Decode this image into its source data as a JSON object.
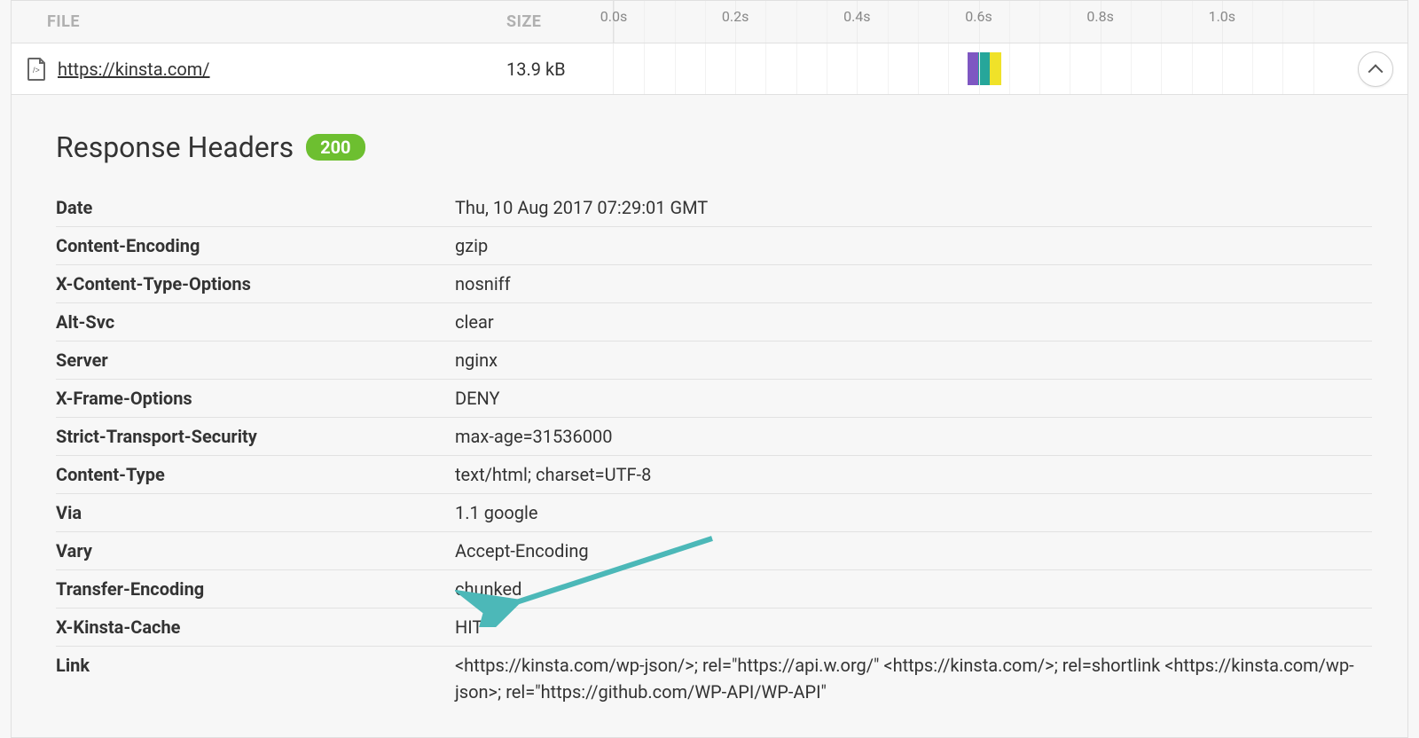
{
  "columns": {
    "file": "FILE",
    "size": "SIZE"
  },
  "timeline": {
    "ticks": [
      {
        "label": "0.0s",
        "pct": 0
      },
      {
        "label": "0.2s",
        "pct": 16.666
      },
      {
        "label": "0.4s",
        "pct": 33.333
      },
      {
        "label": "0.6s",
        "pct": 50
      },
      {
        "label": "0.8s",
        "pct": 66.666
      },
      {
        "label": "1.0s",
        "pct": 83.333
      }
    ],
    "minor_ticks_pct": [
      4.166,
      8.333,
      12.5,
      20.833,
      25,
      29.166,
      37.5,
      41.666,
      45.833,
      54.166,
      58.333,
      62.5,
      70.833,
      75,
      79.166,
      87.5,
      91.666,
      95.833
    ]
  },
  "file": {
    "url": "https://kinsta.com/",
    "size": "13.9 kB",
    "waterfall": {
      "segments": [
        {
          "color": "#7e57c2",
          "start_pct": 48.5,
          "width_pct": 1.4
        },
        {
          "color": "#26a69a",
          "start_pct": 49.9,
          "width_pct": 1.6
        },
        {
          "color": "#f0e229",
          "start_pct": 51.5,
          "width_pct": 1.6
        }
      ]
    }
  },
  "section": {
    "title": "Response Headers",
    "status": "200"
  },
  "headers": [
    {
      "key": "Date",
      "value": "Thu, 10 Aug 2017 07:29:01 GMT"
    },
    {
      "key": "Content-Encoding",
      "value": "gzip"
    },
    {
      "key": "X-Content-Type-Options",
      "value": "nosniff"
    },
    {
      "key": "Alt-Svc",
      "value": "clear"
    },
    {
      "key": "Server",
      "value": "nginx"
    },
    {
      "key": "X-Frame-Options",
      "value": "DENY"
    },
    {
      "key": "Strict-Transport-Security",
      "value": "max-age=31536000"
    },
    {
      "key": "Content-Type",
      "value": "text/html; charset=UTF-8"
    },
    {
      "key": "Via",
      "value": "1.1 google"
    },
    {
      "key": "Vary",
      "value": "Accept-Encoding"
    },
    {
      "key": "Transfer-Encoding",
      "value": "chunked"
    },
    {
      "key": "X-Kinsta-Cache",
      "value": "HIT"
    },
    {
      "key": "Link",
      "value": "<https://kinsta.com/wp-json/>; rel=\"https://api.w.org/\" <https://kinsta.com/>; rel=shortlink <https://kinsta.com/wp-json>; rel=\"https://github.com/WP-API/WP-API\""
    }
  ],
  "annotation": {
    "color": "#4cb8b8"
  }
}
